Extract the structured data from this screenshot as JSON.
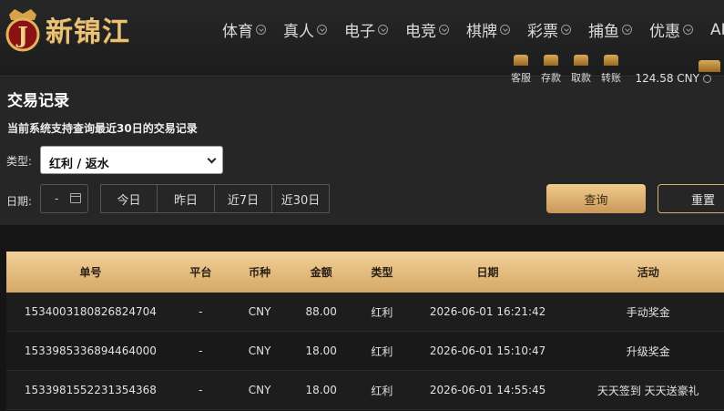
{
  "brand": {
    "name": "新锦江",
    "badge": "J"
  },
  "nav": {
    "items": [
      "体育",
      "真人",
      "电子",
      "电竞",
      "棋牌",
      "彩票",
      "捕鱼",
      "优惠",
      "APP"
    ]
  },
  "quick": {
    "items": [
      "客服",
      "存款",
      "取款",
      "转账"
    ],
    "balance": "124.58 CNY"
  },
  "page": {
    "title": "交易记录",
    "subtitle": "当前系统支持查询最近30日的交易记录"
  },
  "filters": {
    "type_label": "类型:",
    "type_value": "红利 / 返水",
    "date_label": "日期:",
    "date_value": "-",
    "ranges": [
      "今日",
      "昨日",
      "近7日",
      "近30日"
    ],
    "query": "查询",
    "reset": "重置"
  },
  "table": {
    "headers": [
      "单号",
      "平台",
      "币种",
      "金额",
      "类型",
      "日期",
      "活动"
    ],
    "rows": [
      [
        "1534003180826824704",
        "-",
        "CNY",
        "88.00",
        "红利",
        "2026-06-01 16:21:42",
        "手动奖金"
      ],
      [
        "1533985336894464000",
        "-",
        "CNY",
        "18.00",
        "红利",
        "2026-06-01 15:10:47",
        "升级奖金"
      ],
      [
        "1533981552231354368",
        "-",
        "CNY",
        "18.00",
        "红利",
        "2026-06-01 14:55:45",
        "天天签到 天天送豪礼"
      ]
    ]
  }
}
